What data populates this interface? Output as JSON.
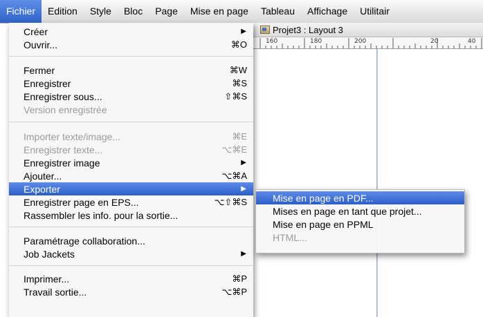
{
  "menubar": {
    "items": [
      {
        "label": "Fichier",
        "active": true
      },
      {
        "label": "Edition"
      },
      {
        "label": "Style"
      },
      {
        "label": "Bloc"
      },
      {
        "label": "Page"
      },
      {
        "label": "Mise en page"
      },
      {
        "label": "Tableau"
      },
      {
        "label": "Affichage"
      },
      {
        "label": "Utilitair"
      }
    ]
  },
  "document": {
    "title": "Projet3 : Layout 3",
    "ruler_labels": [
      "160",
      "180",
      "200",
      "20",
      "40"
    ]
  },
  "fichier_menu": {
    "items": [
      {
        "label": "Créer",
        "shortcut": "",
        "submenu": true
      },
      {
        "label": "Ouvrir...",
        "shortcut": "⌘O"
      },
      {
        "label": "Fermer",
        "shortcut": "⌘W"
      },
      {
        "label": "Enregistrer",
        "shortcut": "⌘S"
      },
      {
        "label": "Enregistrer sous...",
        "shortcut": "⇧⌘S"
      },
      {
        "label": "Version enregistrée",
        "shortcut": "",
        "disabled": true
      },
      {
        "label": "Importer texte/image...",
        "shortcut": "⌘E",
        "disabled": true
      },
      {
        "label": "Enregistrer texte...",
        "shortcut": "⌥⌘E",
        "disabled": true
      },
      {
        "label": "Enregistrer image",
        "shortcut": "",
        "submenu": true
      },
      {
        "label": "Ajouter...",
        "shortcut": "⌥⌘A"
      },
      {
        "label": "Exporter",
        "shortcut": "",
        "submenu": true,
        "selected": true
      },
      {
        "label": "Enregistrer page en EPS...",
        "shortcut": "⌥⇧⌘S"
      },
      {
        "label": "Rassembler les info. pour la sortie...",
        "shortcut": ""
      },
      {
        "label": "Paramétrage collaboration...",
        "shortcut": ""
      },
      {
        "label": "Job Jackets",
        "shortcut": "",
        "submenu": true
      },
      {
        "label": "Imprimer...",
        "shortcut": "⌘P"
      },
      {
        "label": "Travail sortie...",
        "shortcut": "⌥⌘P"
      }
    ]
  },
  "export_menu": {
    "items": [
      {
        "label": "Mise en page en PDF...",
        "selected": true
      },
      {
        "label": "Mises en page en tant que projet..."
      },
      {
        "label": "Mise en page en PPML"
      },
      {
        "label": "HTML...",
        "disabled": true
      }
    ]
  },
  "colors": {
    "selection": "#2f63c8",
    "menu_background": "#f7f7f7",
    "disabled_text": "#9a9a9a"
  }
}
